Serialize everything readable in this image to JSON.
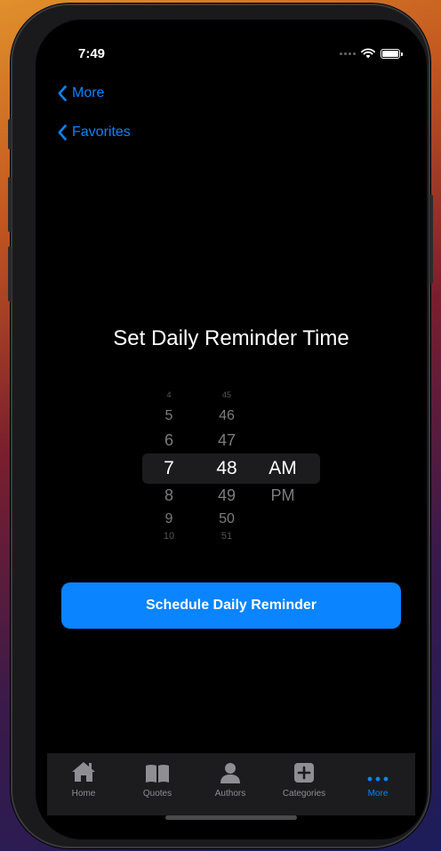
{
  "status_bar": {
    "time": "7:49"
  },
  "nav": {
    "back_primary": "More",
    "back_secondary": "Favorites"
  },
  "main": {
    "title": "Set Daily Reminder Time"
  },
  "picker": {
    "hours": [
      "4",
      "5",
      "6",
      "7",
      "8",
      "9",
      "10"
    ],
    "minutes": [
      "45",
      "46",
      "47",
      "48",
      "49",
      "50",
      "51"
    ],
    "periods": [
      "AM",
      "PM"
    ],
    "selected_hour": "7",
    "selected_minute": "48",
    "selected_period": "AM"
  },
  "actions": {
    "schedule_label": "Schedule Daily Reminder"
  },
  "tabbar": {
    "tabs": [
      {
        "label": "Home",
        "icon": "house-icon"
      },
      {
        "label": "Quotes",
        "icon": "book-icon"
      },
      {
        "label": "Authors",
        "icon": "person-icon"
      },
      {
        "label": "Categories",
        "icon": "plus-square-icon"
      },
      {
        "label": "More",
        "icon": "ellipsis-icon"
      }
    ],
    "active": "More"
  },
  "colors": {
    "accent": "#0a84ff",
    "background": "#000000",
    "tabbar": "#1c1c1e",
    "inactive": "#8e8e93"
  }
}
